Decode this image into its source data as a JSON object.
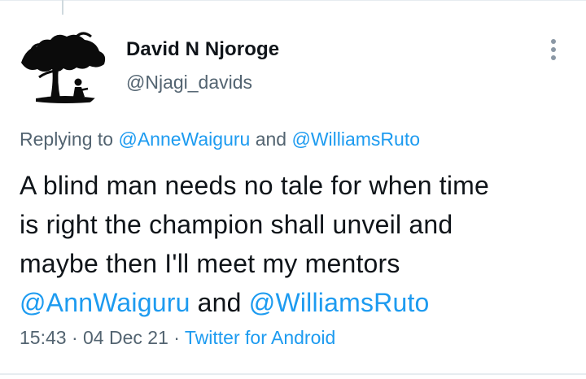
{
  "tweet": {
    "author": {
      "name": "David N Njoroge",
      "handle": "@Njagi_davids"
    },
    "replying": {
      "prefix": "Replying to ",
      "mention1": "@AnneWaiguru",
      "joiner": " and ",
      "mention2": "@WilliamsRuto"
    },
    "text": {
      "line1": "A blind man needs no tale for when time",
      "line2": "is right the champion shall unveil and",
      "line3": "maybe then I'll meet my mentors",
      "mention1": "@AnnWaiguru",
      "joiner": " and ",
      "mention2": "@WilliamsRuto"
    },
    "meta": {
      "time": "15:43",
      "sep1": " · ",
      "date": "04 Dec 21",
      "sep2": " · ",
      "source": "Twitter for Android"
    }
  },
  "icons": {
    "more": "more-vertical-icon",
    "avatar": "tree-silhouette-avatar"
  },
  "colors": {
    "link": "#1d9bf0",
    "secondary": "#536471",
    "text": "#0f1419"
  }
}
